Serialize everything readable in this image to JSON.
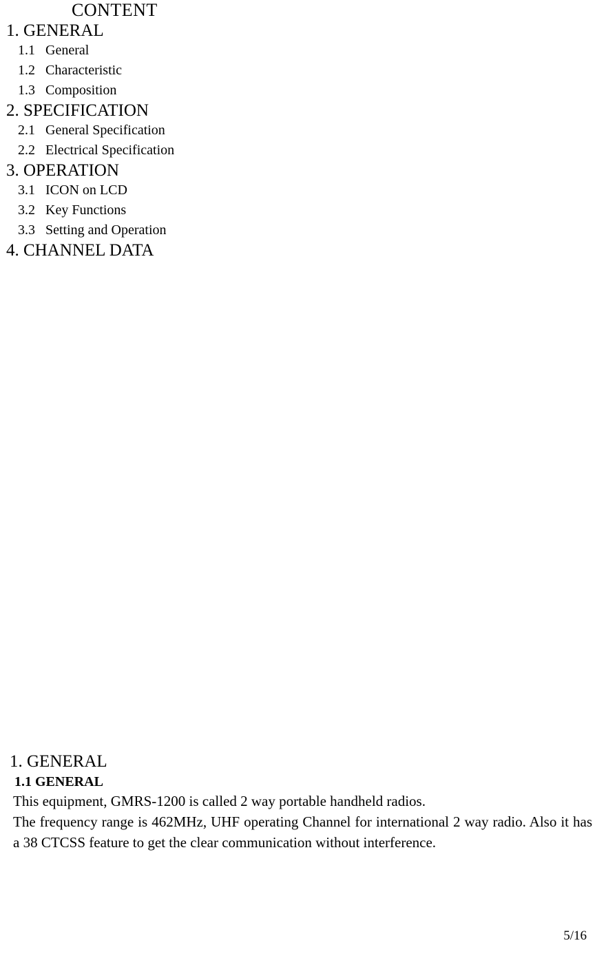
{
  "document": {
    "page_number": "5/16"
  },
  "toc": {
    "title": "CONTENT",
    "entries": [
      {
        "number": "1.",
        "label": "GENERAL",
        "level": 1
      },
      {
        "number": "1.1",
        "label": "General",
        "level": 2
      },
      {
        "number": "1.2",
        "label": "Characteristic",
        "level": 2
      },
      {
        "number": "1.3",
        "label": "Composition",
        "level": 2
      },
      {
        "number": "2.",
        "label": "SPECIFICATION",
        "level": 1
      },
      {
        "number": "2.1",
        "label": "General Specification",
        "level": 2
      },
      {
        "number": "2.2",
        "label": "Electrical Specification",
        "level": 2
      },
      {
        "number": "3.",
        "label": "OPERATION",
        "level": 1
      },
      {
        "number": "3.1",
        "label": "ICON on LCD",
        "level": 2
      },
      {
        "number": "3.2",
        "label": "Key Functions",
        "level": 2
      },
      {
        "number": "3.3",
        "label": "Setting and Operation",
        "level": 2
      },
      {
        "number": "4.",
        "label": "CHANNEL DATA",
        "level": 1
      }
    ]
  },
  "section": {
    "heading": "1. GENERAL",
    "subsection_heading": "1.1 GENERAL",
    "paragraph_line_1": "This equipment, GMRS-1200 is called 2 way portable handheld radios.",
    "paragraph_body": "The frequency range is 462MHz, UHF operating Channel for international 2 way radio. Also it has a 38 CTCSS feature to get the clear communication without interference."
  }
}
